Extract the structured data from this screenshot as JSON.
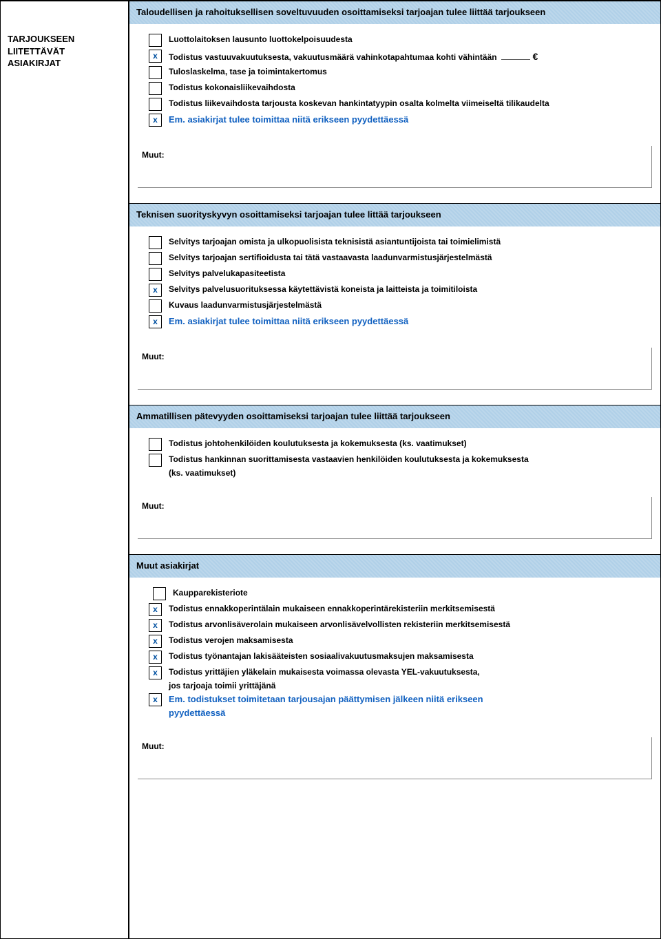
{
  "sidebar": {
    "line1": "TARJOUKSEEN",
    "line2": "LIITETTÄVÄT",
    "line3": "ASIAKIRJAT"
  },
  "section1": {
    "heading": "Taloudellisen ja rahoituksellisen soveltuvuuden osoittamiseksi tarjoajan tulee liittää tarjoukseen",
    "items": [
      {
        "checked": false,
        "text": "Luottolaitoksen lausunto luottokelpoisuudesta"
      },
      {
        "checked": true,
        "text": "Todistus vastuuvakuutuksesta, vakuutusmäärä vahinkotapahtumaa kohti vähintään",
        "euro": true
      },
      {
        "checked": false,
        "text": "Tuloslaskelma, tase ja toimintakertomus"
      },
      {
        "checked": false,
        "text": "Todistus kokonaisliikevaihdosta"
      },
      {
        "checked": false,
        "text": "Todistus liikevaihdosta tarjousta koskevan hankintatyypin osalta kolmelta viimeiseltä tilikaudelta"
      },
      {
        "checked": true,
        "blue": true,
        "text": "Em. asiakirjat tulee toimittaa niitä erikseen pyydettäessä"
      }
    ],
    "muut": "Muut:"
  },
  "section2": {
    "heading": "Teknisen suorityskyvyn osoittamiseksi tarjoajan tulee littää tarjoukseen",
    "items": [
      {
        "checked": false,
        "text": "Selvitys tarjoajan omista ja ulkopuolisista teknisistä asiantuntijoista tai toimielimistä"
      },
      {
        "checked": false,
        "text": "Selvitys tarjoajan sertifioidusta tai tätä vastaavasta laadunvarmistusjärjestelmästä"
      },
      {
        "checked": false,
        "text": "Selvitys palvelukapasiteetista"
      },
      {
        "checked": true,
        "text": "Selvitys palvelusuorituksessa käytettävistä koneista ja laitteista ja toimitiloista"
      },
      {
        "checked": false,
        "text": "Kuvaus laadunvarmistusjärjestelmästä"
      },
      {
        "checked": true,
        "blue": true,
        "text": "Em. asiakirjat tulee toimittaa niitä erikseen pyydettäessä"
      }
    ],
    "muut": "Muut:"
  },
  "section3": {
    "heading": "Ammatillisen pätevyyden osoittamiseksi tarjoajan tulee liittää tarjoukseen",
    "items": [
      {
        "checked": false,
        "text": "Todistus johtohenkilöiden koulutuksesta ja kokemuksesta (ks. vaatimukset)"
      },
      {
        "checked": false,
        "text": "Todistus hankinnan suorittamisesta vastaavien henkilöiden koulutuksesta ja kokemuksesta",
        "cont": "(ks. vaatimukset)"
      }
    ],
    "muut": "Muut:"
  },
  "section4": {
    "heading": "Muut asiakirjat",
    "items": [
      {
        "checked": false,
        "text": "Kaupparekisteriote",
        "indent": true
      },
      {
        "checked": true,
        "text": "Todistus ennakkoperintälain mukaiseen ennakkoperintärekisteriin merkitsemisestä"
      },
      {
        "checked": true,
        "text": "Todistus arvonlisäverolain mukaiseen arvonlisävelvollisten rekisteriin merkitsemisestä"
      },
      {
        "checked": true,
        "text": "Todistus verojen maksamisesta"
      },
      {
        "checked": true,
        "text": "Todistus työnantajan lakisääteisten sosiaalivakuutusmaksujen maksamisesta"
      },
      {
        "checked": true,
        "text": "Todistus yrittäjien yläkelain mukaisesta voimassa olevasta YEL-vakuutuksesta,",
        "cont": "jos tarjoaja toimii yrittäjänä"
      },
      {
        "checked": true,
        "blue": true,
        "text": "Em. todistukset toimitetaan tarjousajan päättymisen jälkeen niitä erikseen",
        "cont_blue": "pyydettäessä"
      }
    ],
    "muut": "Muut:"
  },
  "euro_symbol": "€"
}
